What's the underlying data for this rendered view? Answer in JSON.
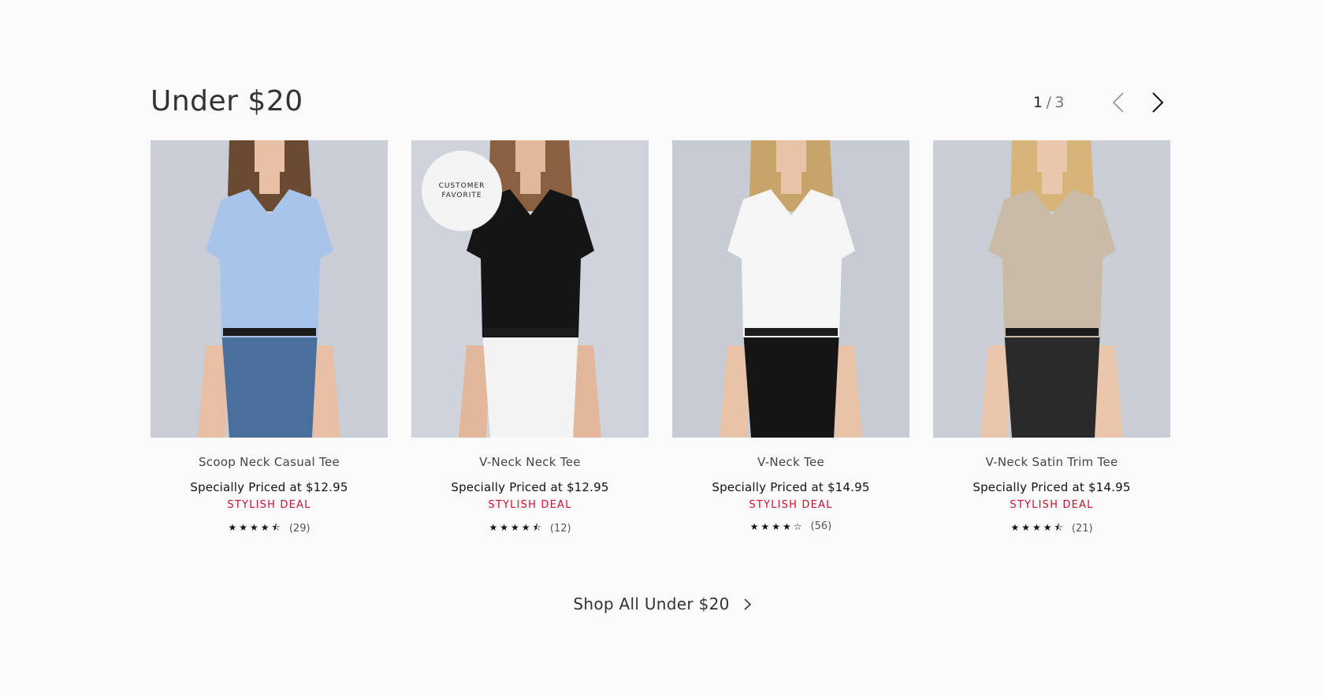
{
  "section": {
    "title": "Under $20",
    "pager": {
      "current": "1",
      "separator": "/",
      "total": "3"
    }
  },
  "products": [
    {
      "name": "Scoop Neck Casual Tee",
      "price": "Specially Priced at $12.95",
      "deal": "STYLISH DEAL",
      "rating": 4.5,
      "stars": "★★★★⯪",
      "reviews": "(29)",
      "badge": null,
      "colors": {
        "bg": "#c9ced6",
        "top": "#a9c4ea",
        "bottom": "#4a6f9c",
        "skin": "#e6bfa5",
        "hair": "#6b4a32"
      }
    },
    {
      "name": "V-Neck Neck Tee",
      "price": "Specially Priced at $12.95",
      "deal": "STYLISH DEAL",
      "rating": 4.5,
      "stars": "★★★★⯪",
      "reviews": "(12)",
      "badge": {
        "line1": "CUSTOMER",
        "line2": "FAVORITE"
      },
      "colors": {
        "bg": "#cfd4dc",
        "top": "#151515",
        "bottom": "#f3f3f3",
        "skin": "#e2b79c",
        "hair": "#8a6040"
      }
    },
    {
      "name": "V-Neck Tee",
      "price": "Specially Priced at $14.95",
      "deal": "STYLISH DEAL",
      "rating": 4,
      "stars": "★★★★☆",
      "reviews": "(56)",
      "badge": null,
      "colors": {
        "bg": "#c7ccd4",
        "top": "#f5f5f5",
        "bottom": "#151515",
        "skin": "#e8c3a8",
        "hair": "#c9a46a"
      }
    },
    {
      "name": "V-Neck Satin Trim Tee",
      "price": "Specially Priced at $14.95",
      "deal": "STYLISH DEAL",
      "rating": 4.5,
      "stars": "★★★★⯪",
      "reviews": "(21)",
      "badge": null,
      "colors": {
        "bg": "#c9ced6",
        "top": "#c9bba6",
        "bottom": "#2a2a2a",
        "skin": "#eac6ad",
        "hair": "#d6b47a"
      }
    }
  ],
  "shop_all": {
    "label": "Shop All Under $20"
  }
}
